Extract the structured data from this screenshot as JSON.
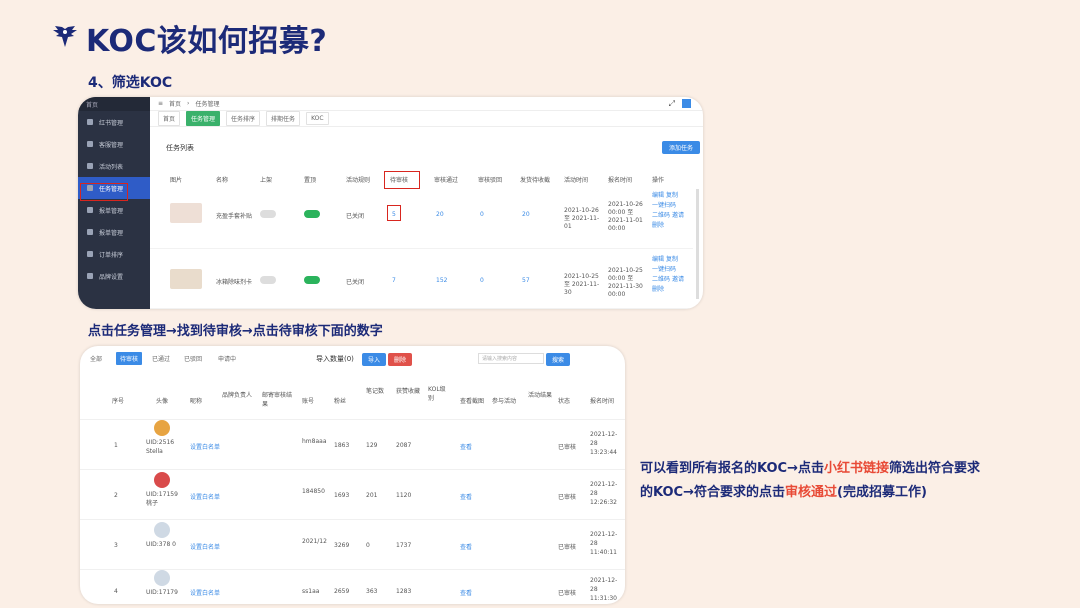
{
  "title": "KOC该如何招募?",
  "subtitle": "4、筛选KOC",
  "screenshot1": {
    "sidebar_head": "首页",
    "sidebar_items": [
      "红书管理",
      "客服管理",
      "活动列表",
      "任务管理",
      "报单管理",
      "报单管理",
      "订单排序",
      "品牌设置"
    ],
    "breadcrumb": [
      "首页",
      "任务管理"
    ],
    "tabs": [
      "首页",
      "任务管理",
      "任务排序",
      "排期任务",
      "KOC"
    ],
    "card_title": "任务列表",
    "add_button": "添加任务",
    "columns": [
      "图片",
      "名称",
      "上架",
      "置顶",
      "活动规则",
      "待审核",
      "审核通过",
      "审核驳回",
      "发货待收截",
      "活动时间",
      "报名时间",
      "操作"
    ],
    "rows": [
      {
        "name": "充盈手套补贴",
        "rule": "已关闭",
        "pending": "5",
        "approved": "20",
        "rejected": "0",
        "shipped": "20",
        "activity_time": "2021-10-26 至 2021-11-01",
        "signup_time": "2021-10-26 00:00 至 2021-11-01 00:00",
        "ops": [
          "编辑",
          "复制",
          "一键扫码",
          "二维码",
          "邀请",
          "删除"
        ]
      },
      {
        "name": "冰箱除味剂卡",
        "rule": "已关闭",
        "pending": "7",
        "approved": "152",
        "rejected": "0",
        "shipped": "57",
        "activity_time": "2021-10-25 至 2021-11-30",
        "signup_time": "2021-10-25 00:00 至 2021-11-30 00:00",
        "ops": [
          "编辑",
          "复制",
          "一键扫码",
          "二维码",
          "邀请",
          "删除"
        ]
      }
    ]
  },
  "instruction1": "点击任务管理→找到待审核→点击待审核下面的数字",
  "screenshot2": {
    "tabs": [
      "全部",
      "待审核",
      "已通过",
      "已驳回",
      "申请中"
    ],
    "import_label": "导入数量(0)",
    "import_button": "导入",
    "delete_button": "删除",
    "search_placeholder": "请输入搜索内容",
    "search_button": "搜索",
    "columns": [
      "序号",
      "头像",
      "昵称",
      "品牌负责人",
      "邮寄审核结果",
      "账号",
      "粉丝",
      "笔记数",
      "获赞收藏",
      "KOL级别",
      "查看截图",
      "参与活动",
      "活动结果",
      "状态",
      "报名时间"
    ],
    "rows": [
      {
        "index": "1",
        "uid": "UID:2516 Stella",
        "link": "设置白名单",
        "account": "hm8aaa",
        "fans": "1863",
        "notes": "129",
        "likes": "2087",
        "view": "查看",
        "status": "已审核",
        "time": "2021-12-28 13:23:44"
      },
      {
        "index": "2",
        "uid": "UID:17159 桃子",
        "link": "设置白名单",
        "account": "184850",
        "fans": "1693",
        "notes": "201",
        "likes": "1120",
        "view": "查看",
        "status": "已审核",
        "time": "2021-12-28 12:26:32"
      },
      {
        "index": "3",
        "uid": "UID:378 0",
        "link": "设置白名单",
        "account": "2021/12",
        "fans": "3269",
        "notes": "0",
        "likes": "1737",
        "view": "查看",
        "status": "已审核",
        "time": "2021-12-28 11:40:11"
      },
      {
        "index": "4",
        "uid": "UID:17179",
        "link": "设置白名单",
        "account": "ss1aa",
        "fans": "2659",
        "notes": "363",
        "likes": "1283",
        "view": "查看",
        "status": "已审核",
        "time": "2021-12-28 11:31:30"
      }
    ]
  },
  "description": {
    "part1": "可以看到所有报名的KOC→点击",
    "hl1": "小红书链接",
    "part2": "筛选出符合要求",
    "part3": "的KOC→符合要求的点击",
    "hl2": "审核通过",
    "part4": "(完成招募工作)"
  },
  "colors": {
    "navy": "#1c2a78",
    "highlight": "#e84a36",
    "accent": "#3b8be6",
    "active_green": "#2bb35c"
  }
}
